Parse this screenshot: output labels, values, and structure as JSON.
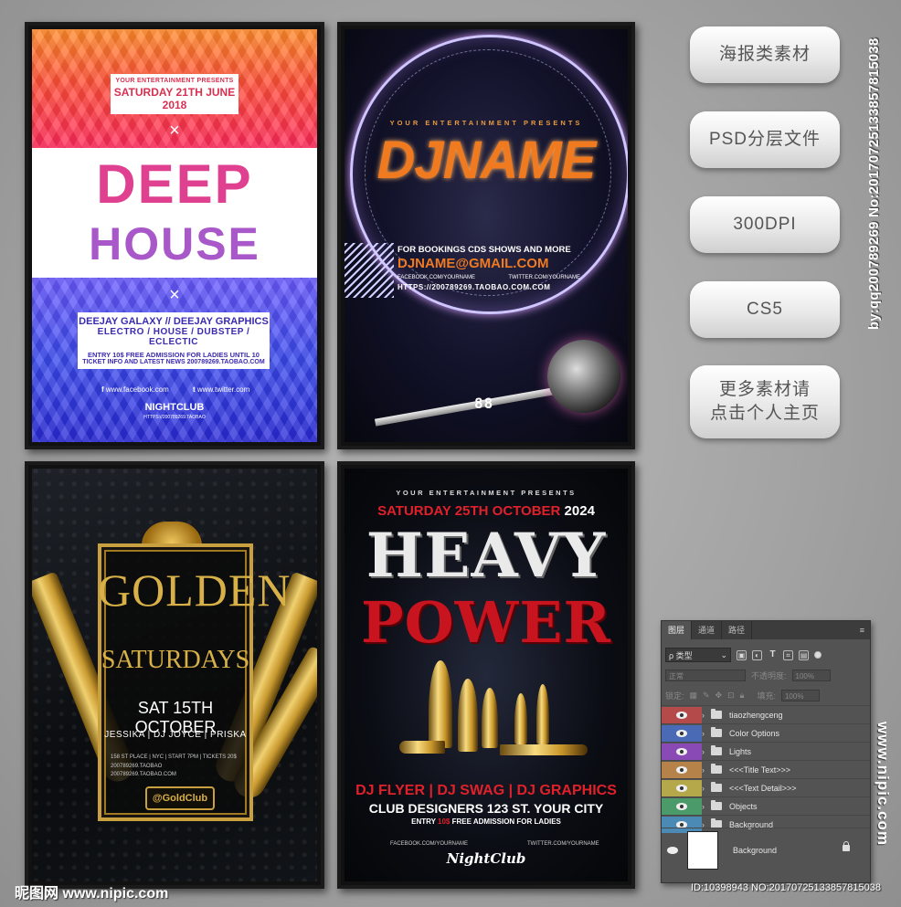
{
  "posters": {
    "deep_house": {
      "presents": "YOUR ENTERTAINMENT PRESENTS",
      "date": "SATURDAY 21TH JUNE 2018",
      "cross": "×",
      "title_line1": "DEEP",
      "title_line2": "HOUSE",
      "djs": "DEEJAY GALAXY // DEEJAY GRAPHICS",
      "genres": "ELECTRO / HOUSE / DUBSTEP / ECLECTIC",
      "entry": "ENTRY 10$ FREE ADMISSION FOR LADIES UNTIL 10",
      "ticket": "TICKET INFO AND LATEST NEWS 200789269.TAOBAO.COM",
      "facebook": "www.facebook.com",
      "twitter": "www.twitter.com",
      "club": "NIGHTCLUB",
      "club_url": "HTTPS://200789269.TAOBAO"
    },
    "dj_name": {
      "presents": "YOUR ENTERTAINMENT PRESENTS",
      "title": "DJNAME",
      "bookings": "FOR BOOKINGS CDS SHOWS AND MORE",
      "email": "DJNAME@GMAIL.COM",
      "facebook": "FACEBOOK.COM/YOURNAME",
      "twitter": "TWITTER.COM/YOURNAME",
      "url": "HTTPS://200789269.TAOBAO.COM.COM",
      "digits": "88"
    },
    "golden": {
      "title_line1": "GOLDEN",
      "title_line2": "SATURDAYS",
      "date": "SAT 15TH OCTOBER",
      "djs": "JESSIKA | DJ JOYCE | PRISKA",
      "address": "158 ST PLACE | NYC | START 7PM | TICKETS 20$",
      "facebook": "200789269.TAOBAO",
      "web": "200789269.TAOBAO.COM",
      "club": "@GoldClub"
    },
    "heavy_power": {
      "presents": "YOUR ENTERTAINMENT PRESENTS",
      "date_pre": "SATURDAY 25TH OCTOBER",
      "date_year": " 2024",
      "title_line1": "HEAVY",
      "title_line2": "POWER",
      "djs": "DJ FLYER | DJ SWAG | DJ GRAPHICS",
      "address": "CLUB DESIGNERS 123 ST. YOUR CITY",
      "entry_pre": "ENTRY ",
      "entry_price": "10$",
      "entry_post": " FREE ADMISSION FOR LADIES",
      "facebook": "FACEBOOK.COM/YOURNAME",
      "twitter": "TWITTER.COM/YOURNAME",
      "club": "NightClub"
    }
  },
  "side_buttons": {
    "b1": "海报类素材",
    "b2": "PSD分层文件",
    "b3": "300DPI",
    "b4": "CS5",
    "b5_line1": "更多素材请",
    "b5_line2": "点击个人主页"
  },
  "watermark": {
    "vertical_id": "by:qq200789269 No:20170725133857815038",
    "site_vertical": "www.nipic.com",
    "logo": "昵图网 www.nipic.com",
    "bottom_id": "ID:10398943 NO:20170725133857815038"
  },
  "layers_panel": {
    "tabs": [
      "图层",
      "通道",
      "路径"
    ],
    "filter_label": "ρ 类型",
    "blend_mode": "正常",
    "opacity_label": "不透明度:",
    "opacity_value": "100%",
    "lock_label": "锁定:",
    "fill_label": "填充:",
    "fill_value": "100%",
    "layers": [
      {
        "name": "tiaozhengceng",
        "color": "#b54a4a"
      },
      {
        "name": "Color Options",
        "color": "#4a6ab5"
      },
      {
        "name": "Lights",
        "color": "#8a4ab5"
      },
      {
        "name": "<<<Title Text>>>",
        "color": "#b5834a"
      },
      {
        "name": "<<<Text Detail>>>",
        "color": "#b5a84a"
      },
      {
        "name": "Objects",
        "color": "#4a9a6a"
      },
      {
        "name": "Background",
        "color": "#4a8ab5"
      }
    ],
    "bg_layer_name": "Background"
  }
}
